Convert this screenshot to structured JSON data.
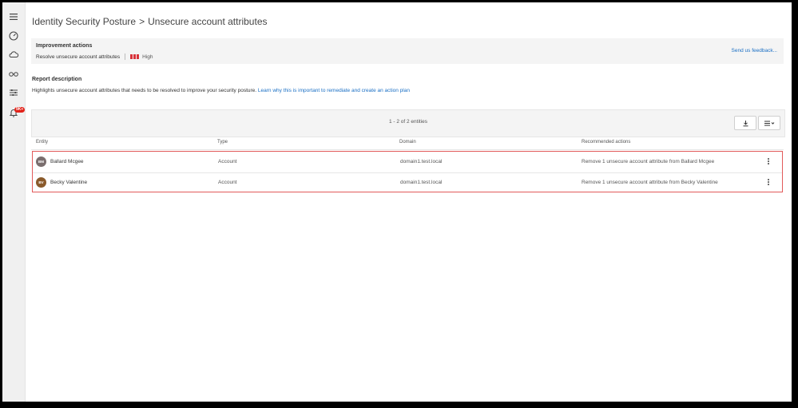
{
  "nav": {
    "items": [
      {
        "name": "menu-icon"
      },
      {
        "name": "dashboard-icon"
      },
      {
        "name": "cloud-icon"
      },
      {
        "name": "glasses-icon"
      },
      {
        "name": "filters-icon"
      },
      {
        "name": "bell-icon"
      }
    ],
    "notification_badge": "9K+"
  },
  "breadcrumb": {
    "parent": "Identity Security Posture",
    "separator": ">",
    "current": "Unsecure account attributes"
  },
  "improvement": {
    "label": "Improvement actions",
    "action": "Resolve unsecure account attributes",
    "severity": "High",
    "severity_color": "#d9333a",
    "feedback_link": "Send us feedback..."
  },
  "report": {
    "label": "Report description",
    "description": "Highlights unsecure account attributes that needs to be resolved to improve your security posture.",
    "link": "Learn why this is important to remediate and create an action plan"
  },
  "table": {
    "count_text": "1 - 2 of 2 entities",
    "columns": [
      "Entity",
      "Type",
      "Domain",
      "Recommended actions"
    ],
    "rows": [
      {
        "initials": "BM",
        "avatar_color": "#7a6e6e",
        "entity": "Ballard Mcgee",
        "type": "Account",
        "domain": "domain1.test.local",
        "action": "Remove 1 unsecure account attribute from Ballard Mcgee"
      },
      {
        "initials": "BV",
        "avatar_color": "#8a5a2b",
        "entity": "Becky Valentine",
        "type": "Account",
        "domain": "domain1.test.local",
        "action": "Remove 1 unsecure account attribute from Becky Valentine"
      }
    ],
    "toolbar": {
      "download_icon": "download-icon",
      "columns_icon": "list-view-icon"
    }
  },
  "colors": {
    "accent": "#1a6fc4",
    "highlight": "#e25a5a"
  }
}
